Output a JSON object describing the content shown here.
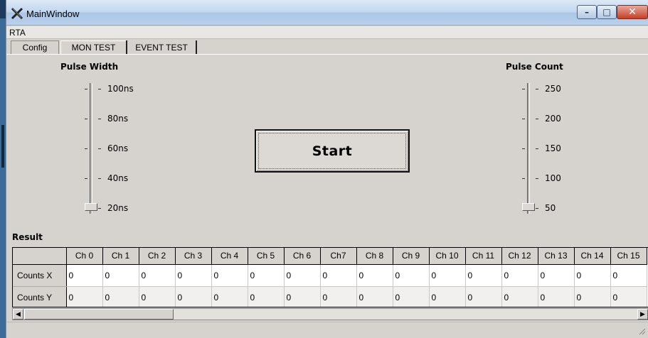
{
  "window": {
    "title": "MainWindow",
    "buttons": {
      "minimize": "–",
      "maximize": "□",
      "close": "✕"
    }
  },
  "menu": {
    "items": [
      "RTA"
    ]
  },
  "tabs": [
    {
      "label": "Config",
      "active": false
    },
    {
      "label": "MON TEST",
      "active": true
    },
    {
      "label": "EVENT TEST",
      "active": false
    }
  ],
  "pulse_width": {
    "title": "Pulse Width",
    "ticks": [
      "100ns",
      "80ns",
      "60ns",
      "40ns",
      "20ns"
    ],
    "value": "20ns"
  },
  "pulse_count": {
    "title": "Pulse Count",
    "ticks": [
      "250",
      "200",
      "150",
      "100",
      "50"
    ],
    "value": "50"
  },
  "start_button": {
    "label": "Start"
  },
  "result": {
    "title": "Result",
    "columns": [
      "Ch 0",
      "Ch 1",
      "Ch 2",
      "Ch 3",
      "Ch 4",
      "Ch 5",
      "Ch 6",
      "Ch7",
      "Ch 8",
      "Ch 9",
      "Ch 10",
      "Ch 11",
      "Ch 12",
      "Ch 13",
      "Ch 14",
      "Ch 15"
    ],
    "rows": [
      {
        "label": "Counts X",
        "values": [
          "0",
          "0",
          "0",
          "0",
          "0",
          "0",
          "0",
          "0",
          "0",
          "0",
          "0",
          "0",
          "0",
          "0",
          "0",
          "0"
        ]
      },
      {
        "label": "Counts Y",
        "values": [
          "0",
          "0",
          "0",
          "0",
          "0",
          "0",
          "0",
          "0",
          "0",
          "0",
          "0",
          "0",
          "0",
          "0",
          "0",
          "0"
        ]
      }
    ]
  },
  "scrollbar": {
    "left_arrow": "◀",
    "right_arrow": "▶"
  },
  "colors": {
    "titlebar": "#c1d6ee",
    "window_bg": "#d6d3ce",
    "close_button": "#c43f2a"
  }
}
